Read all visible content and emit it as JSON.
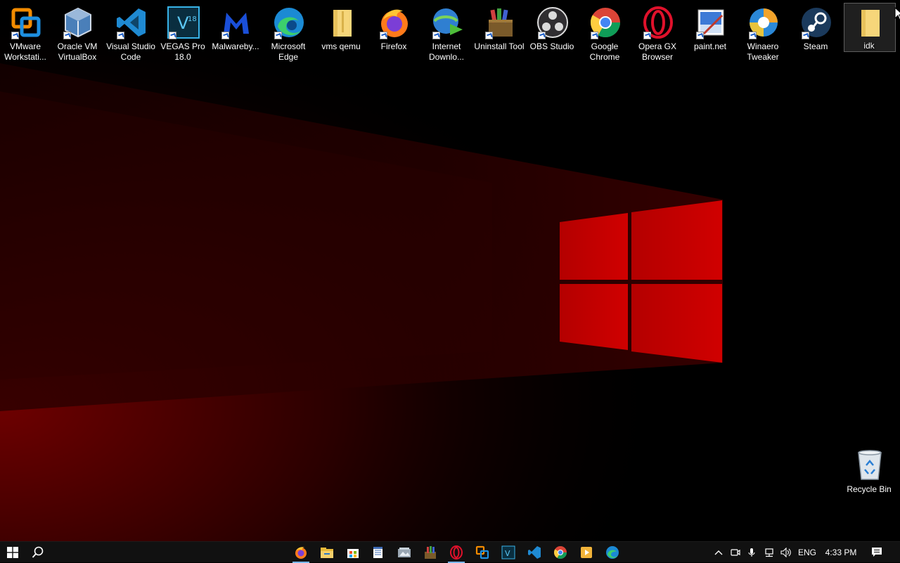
{
  "desktop": {
    "icons": [
      {
        "label": "VMware Workstati...",
        "icon": "vmware-icon"
      },
      {
        "label": "Oracle VM VirtualBox",
        "icon": "virtualbox-icon"
      },
      {
        "label": "Visual Studio Code",
        "icon": "vscode-icon"
      },
      {
        "label": "VEGAS Pro 18.0",
        "icon": "vegas-icon"
      },
      {
        "label": "Malwareby...",
        "icon": "malwarebytes-icon"
      },
      {
        "label": "Microsoft Edge",
        "icon": "edge-icon"
      },
      {
        "label": "vms qemu",
        "icon": "folder-icon"
      },
      {
        "label": "Firefox",
        "icon": "firefox-icon"
      },
      {
        "label": "Internet Downlo...",
        "icon": "idm-icon"
      },
      {
        "label": "Uninstall Tool",
        "icon": "uninstall-tool-icon"
      },
      {
        "label": "OBS Studio",
        "icon": "obs-icon"
      },
      {
        "label": "Google Chrome",
        "icon": "chrome-icon"
      },
      {
        "label": "Opera GX Browser",
        "icon": "opera-gx-icon"
      },
      {
        "label": "paint.net",
        "icon": "paintnet-icon"
      },
      {
        "label": "Winaero Tweaker",
        "icon": "winaero-icon"
      },
      {
        "label": "Steam",
        "icon": "steam-icon"
      },
      {
        "label": "idk",
        "icon": "folder-icon"
      }
    ],
    "recycle_bin": {
      "label": "Recycle Bin",
      "icon": "recycle-bin-icon"
    },
    "selected_icon": "idk"
  },
  "taskbar": {
    "start": "windows-start-icon",
    "search": "search-icon",
    "pinned": [
      "firefox-icon",
      "file-explorer-icon",
      "store-icon",
      "notepad-icon",
      "photos-icon",
      "uninstall-tool-icon",
      "opera-gx-icon",
      "vmware-icon",
      "vegas-icon",
      "vscode-icon",
      "chrome-icon",
      "media-player-icon",
      "edge-icon"
    ],
    "tray": {
      "chevron": "chevron-up-icon",
      "language": "ENG",
      "time": "4:33 PM"
    }
  },
  "colors": {
    "wallpaper_red": "#cc0000",
    "taskbar_bg": "#111111",
    "running_indicator": "#77b7f3"
  }
}
